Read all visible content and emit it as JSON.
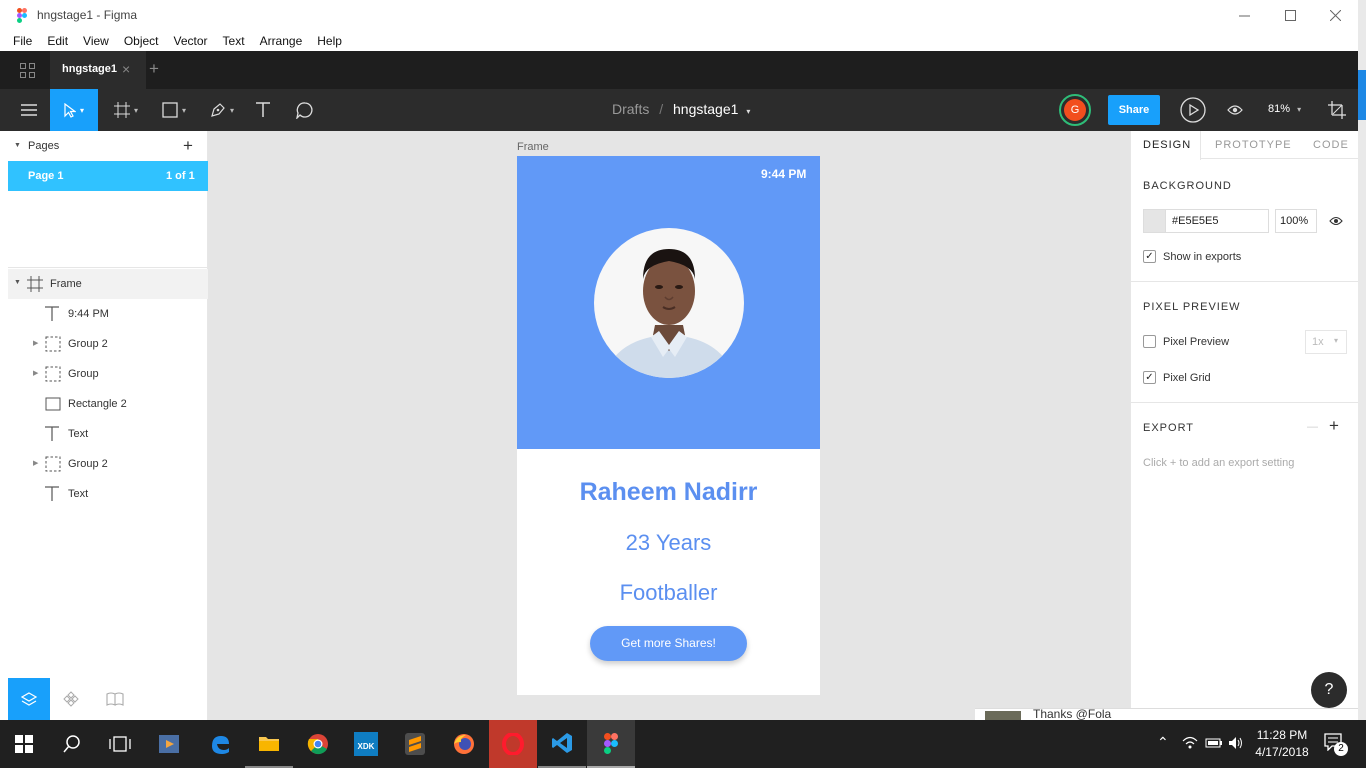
{
  "window": {
    "title": "hngstage1 - Figma"
  },
  "menu": [
    "File",
    "Edit",
    "View",
    "Object",
    "Vector",
    "Text",
    "Arrange",
    "Help"
  ],
  "tabs": {
    "active": "hngstage1",
    "close": "×",
    "add": "+"
  },
  "toolbar": {
    "breadcrumb_root": "Drafts",
    "breadcrumb_sep": "/",
    "file_name": "hngstage1",
    "avatar_initial": "G",
    "share_label": "Share",
    "zoom": "81%"
  },
  "pages": {
    "header": "Pages",
    "add": "+",
    "current": "Page 1",
    "count": "1 of 1"
  },
  "layers": {
    "root": "Frame",
    "items": [
      {
        "label": "9:44 PM",
        "icon": "text-icon",
        "expandable": false
      },
      {
        "label": "Group 2",
        "icon": "group-icon",
        "expandable": true
      },
      {
        "label": "Group",
        "icon": "group-icon",
        "expandable": true
      },
      {
        "label": "Rectangle 2",
        "icon": "rectangle-icon",
        "expandable": false
      },
      {
        "label": "Text",
        "icon": "text-icon",
        "expandable": false
      },
      {
        "label": "Group 2",
        "icon": "group-icon",
        "expandable": true
      },
      {
        "label": "Text",
        "icon": "text-icon",
        "expandable": false
      }
    ]
  },
  "frame": {
    "label": "Frame",
    "time": "9:44 PM",
    "name": "Raheem Nadirr",
    "age": "23 Years",
    "role": "Footballer",
    "cta": "Get more Shares!",
    "header_color": "#6199f7",
    "accent_color": "#5b8ff0"
  },
  "design": {
    "tabs": [
      "DESIGN",
      "PROTOTYPE",
      "CODE"
    ],
    "background_title": "BACKGROUND",
    "background_hex": "#E5E5E5",
    "background_opacity": "100%",
    "show_in_exports": "Show in exports",
    "pixel_preview_title": "PIXEL PREVIEW",
    "pixel_preview_label": "Pixel Preview",
    "pixel_preview_scale": "1x",
    "pixel_grid_label": "Pixel Grid",
    "export_title": "EXPORT",
    "export_minus": "—",
    "export_plus": "+",
    "export_hint": "Click + to add an export setting",
    "help": "?"
  },
  "taskbar": {
    "time": "11:28 PM",
    "date": "4/17/2018",
    "notifications": "2",
    "xdk_label": "XDK",
    "background_peek": "Thanks @Fola"
  }
}
